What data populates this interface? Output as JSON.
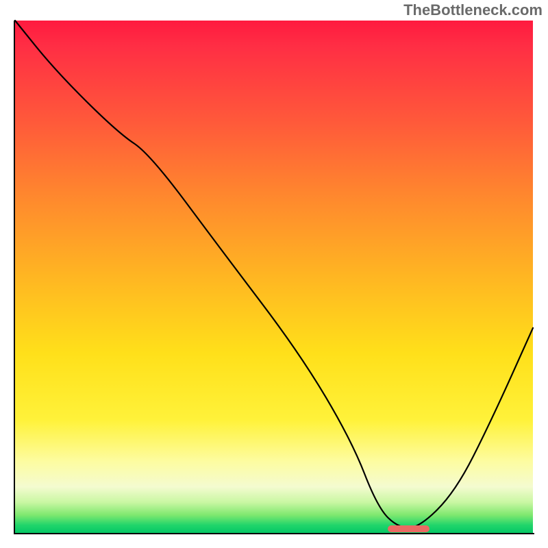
{
  "watermark": "TheBottleneck.com",
  "chart_data": {
    "type": "line",
    "title": "",
    "xlabel": "",
    "ylabel": "",
    "xlim": [
      0,
      100
    ],
    "ylim": [
      0,
      100
    ],
    "grid": false,
    "legend": false,
    "background": "vertical_gradient_red_to_green",
    "series": [
      {
        "name": "bottleneck_curve",
        "x": [
          0,
          8,
          20,
          26,
          40,
          55,
          65,
          70,
          74,
          78,
          85,
          92,
          100
        ],
        "y": [
          100,
          90,
          78,
          74,
          55,
          35,
          18,
          5,
          1,
          1,
          8,
          22,
          40
        ]
      }
    ],
    "optimal_marker": {
      "x_start": 72,
      "x_end": 80,
      "y": 0.8
    },
    "annotations": []
  },
  "colors": {
    "top": "#ff1a3f",
    "mid": "#ffe01a",
    "bottom": "#06c765",
    "curve": "#000000",
    "marker": "#ea6a63",
    "watermark": "#6a6a6a"
  }
}
